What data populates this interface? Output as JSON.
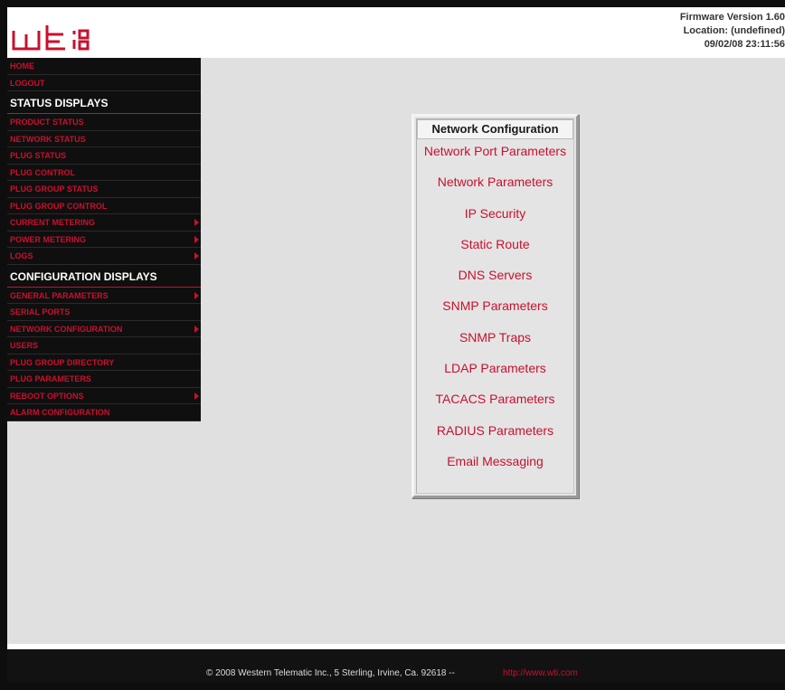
{
  "header": {
    "logo_text": "wti",
    "firmware": "Firmware Version 1.60",
    "location": "Location: (undefined)",
    "datetime": "09/02/08 23:11:56"
  },
  "sidebar": {
    "top_items": [
      {
        "label": "HOME"
      },
      {
        "label": "LOGOUT"
      }
    ],
    "status_title": "STATUS DISPLAYS",
    "status_items": [
      {
        "label": "PRODUCT STATUS",
        "submenu": false
      },
      {
        "label": "NETWORK STATUS",
        "submenu": false
      },
      {
        "label": "PLUG STATUS",
        "submenu": false
      },
      {
        "label": "PLUG CONTROL",
        "submenu": false
      },
      {
        "label": "PLUG GROUP STATUS",
        "submenu": false
      },
      {
        "label": "PLUG GROUP CONTROL",
        "submenu": false
      },
      {
        "label": "CURRENT METERING",
        "submenu": true
      },
      {
        "label": "POWER METERING",
        "submenu": true
      },
      {
        "label": "LOGS",
        "submenu": true
      }
    ],
    "config_title": "CONFIGURATION DISPLAYS",
    "config_items": [
      {
        "label": "GENERAL PARAMETERS",
        "submenu": true
      },
      {
        "label": "SERIAL PORTS",
        "submenu": false
      },
      {
        "label": "NETWORK CONFIGURATION",
        "submenu": true
      },
      {
        "label": "USERS",
        "submenu": false
      },
      {
        "label": "PLUG GROUP DIRECTORY",
        "submenu": false
      },
      {
        "label": "PLUG PARAMETERS",
        "submenu": false
      },
      {
        "label": "REBOOT OPTIONS",
        "submenu": true
      },
      {
        "label": "ALARM CONFIGURATION",
        "submenu": false
      }
    ]
  },
  "network_config": {
    "title": "Network Configuration",
    "links": [
      "Network Port Parameters",
      "Network Parameters",
      "IP Security",
      "Static Route",
      "DNS Servers",
      "SNMP Parameters",
      "SNMP Traps",
      "LDAP Parameters",
      "TACACS Parameters",
      "RADIUS Parameters",
      "Email Messaging"
    ]
  },
  "footer": {
    "copyright": "© 2008 Western Telematic Inc., 5 Sterling, Irvine, Ca. 92618 --",
    "url": "http://www.wti.com"
  },
  "colors": {
    "accent": "#c8102e",
    "sidebar_bg": "#0f0f0f",
    "content_bg": "#e0e0e0"
  }
}
